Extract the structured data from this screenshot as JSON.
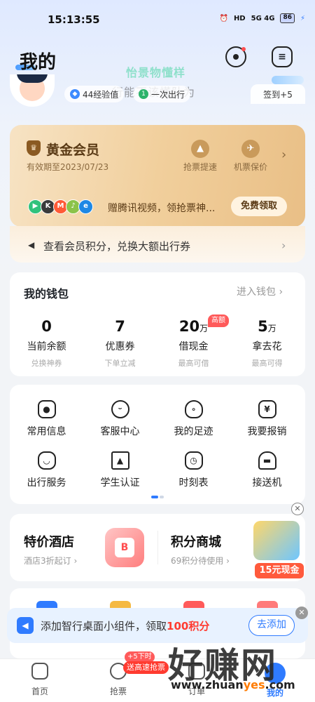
{
  "status_bar": {
    "time": "15:13:55",
    "network": "5G 4G",
    "battery": "86"
  },
  "header": {
    "title": "我的",
    "overlay_line1": "怡景物懂样",
    "overlay_line2": "行能不该懂队为"
  },
  "profile": {
    "exp": "44经验值",
    "level_badge": "1",
    "level": "一次出行",
    "checkin": "签到+5"
  },
  "gold": {
    "title": "黄金会员",
    "valid": "有效期至2023/07/23",
    "benefit1": "抢票提速",
    "benefit2": "机票保价",
    "promo": "赠腾讯视频，领抢票神...",
    "free_btn": "免费领取",
    "member_points": "查看会员积分，兑换大额出行券"
  },
  "wallet": {
    "title": "我的钱包",
    "enter": "进入钱包",
    "items": [
      {
        "value": "0",
        "unit": "",
        "label": "当前余额",
        "sub": "兑换神券"
      },
      {
        "value": "7",
        "unit": "",
        "label": "优惠券",
        "sub": "下单立减"
      },
      {
        "value": "20",
        "unit": "万",
        "label": "借现金",
        "sub": "最高可借",
        "badge": "高额"
      },
      {
        "value": "5",
        "unit": "万",
        "label": "拿去花",
        "sub": "最高可得"
      }
    ]
  },
  "services": [
    {
      "label": "常用信息",
      "icon": "contact-card-icon"
    },
    {
      "label": "客服中心",
      "icon": "smile-face-icon"
    },
    {
      "label": "我的足迹",
      "icon": "footprint-icon"
    },
    {
      "label": "我要报销",
      "icon": "yuan-receipt-icon"
    },
    {
      "label": "出行服务",
      "icon": "bag-icon"
    },
    {
      "label": "学生认证",
      "icon": "graduation-cap-icon"
    },
    {
      "label": "时刻表",
      "icon": "clock-icon"
    },
    {
      "label": "接送机",
      "icon": "car-icon"
    }
  ],
  "promo": {
    "hotel_title": "特价酒店",
    "hotel_sub": "酒店3折起订",
    "mall_title": "积分商城",
    "mall_sub": "69积分待使用",
    "cash": "15元现金"
  },
  "widget": {
    "text_before": "添加智行桌面小组件，领取",
    "text_highlight": "100积分",
    "button": "去添加"
  },
  "tabs": [
    {
      "label": "首页"
    },
    {
      "label": "抢票",
      "badge_small": "+5下时",
      "badge": "送高速抢票"
    },
    {
      "label": "订单"
    },
    {
      "label": "我的",
      "active": true
    }
  ],
  "watermark": {
    "big": "好赚网",
    "url_prefix": "www.zhuan",
    "url_hl": "yes",
    "url_suffix": ".com"
  },
  "colors": {
    "accent": "#2f7bff",
    "gold": "#e9bf86",
    "red": "#ff3b30"
  }
}
